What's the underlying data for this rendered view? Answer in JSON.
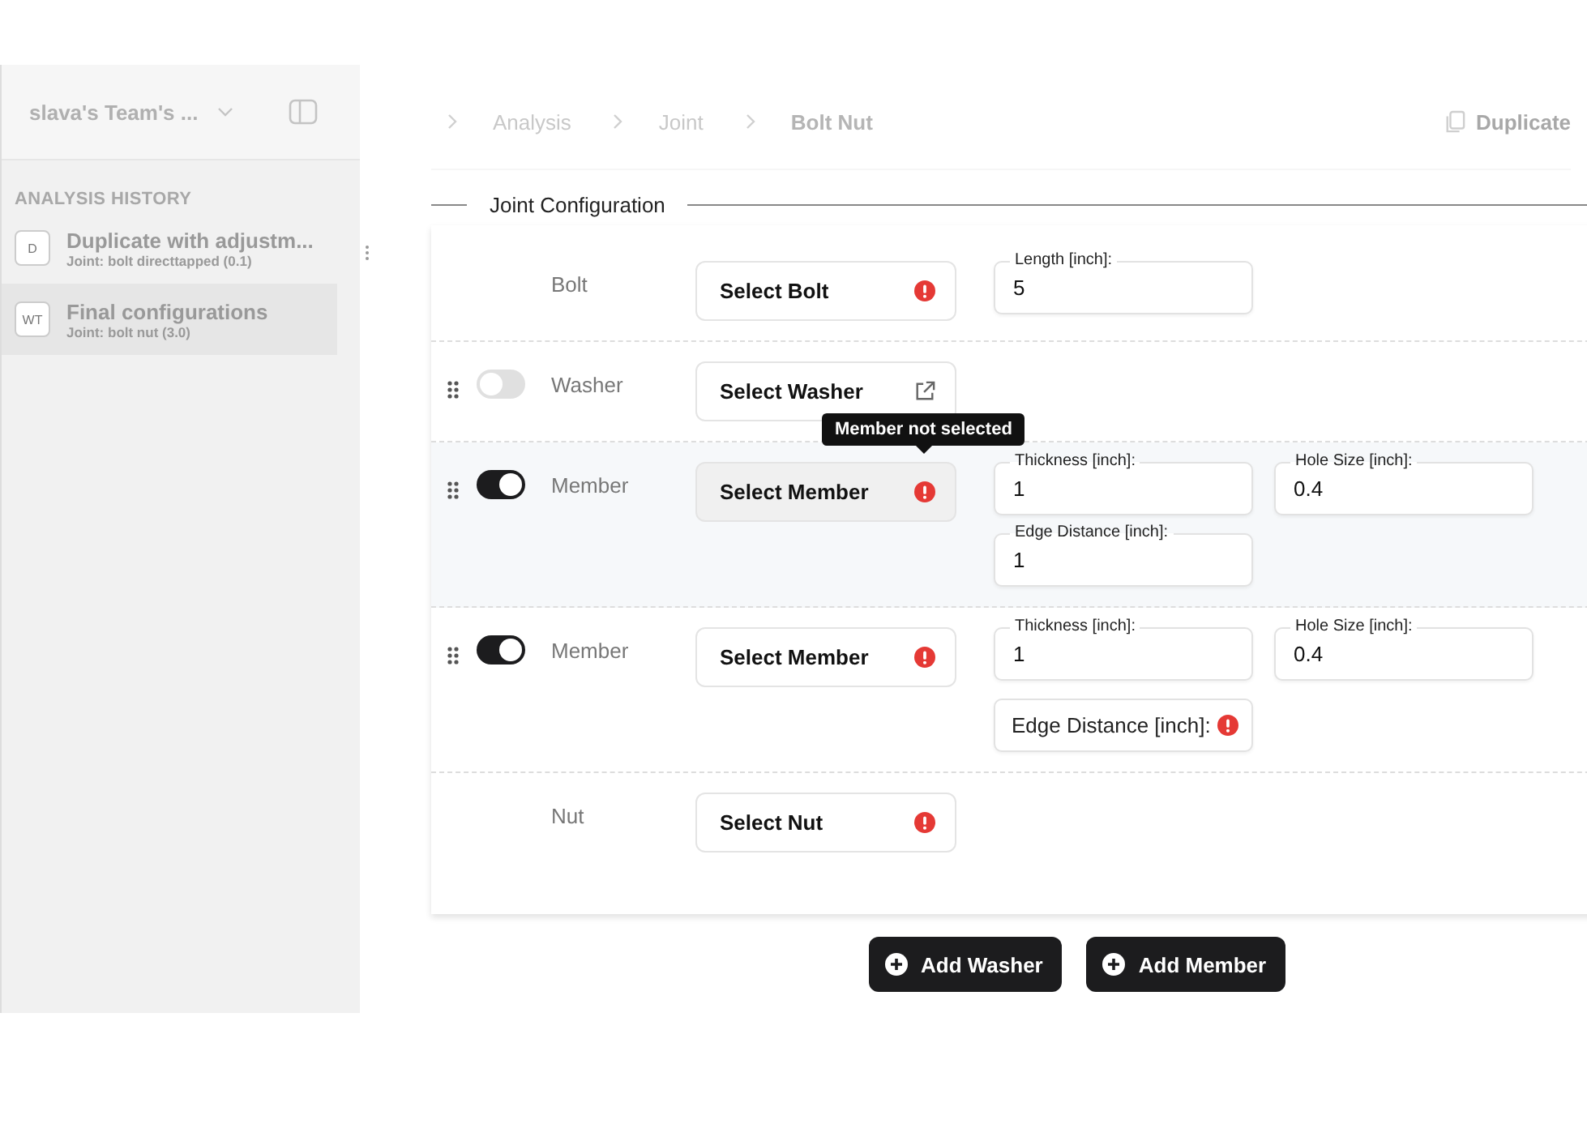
{
  "sidebar": {
    "team": "slava's Team's ...",
    "section_title": "ANALYSIS HISTORY",
    "items": [
      {
        "badge": "D",
        "title": "Duplicate with adjustm...",
        "subtitle": "Joint: bolt directtapped (0.1)",
        "selected": false
      },
      {
        "badge": "WT",
        "title": "Final configurations",
        "subtitle": "Joint: bolt nut (3.0)",
        "selected": true
      }
    ]
  },
  "breadcrumb": [
    "Analysis",
    "Joint",
    "Bolt Nut"
  ],
  "duplicate_button": "Duplicate",
  "section_title": "Joint Configuration",
  "rows": [
    {
      "label": "Bolt",
      "draggable": false,
      "highlighted": false,
      "select": {
        "text": "Select Bolt",
        "error": true,
        "external_link": false
      },
      "fields": [
        {
          "label": "Length [inch]:",
          "value": "5",
          "error": false
        }
      ]
    },
    {
      "label": "Washer",
      "draggable": true,
      "toggle": {
        "on": false
      },
      "highlighted": false,
      "select": {
        "text": "Select Washer",
        "error": false,
        "external_link": true
      },
      "fields": []
    },
    {
      "label": "Member",
      "draggable": true,
      "toggle": {
        "on": true
      },
      "highlighted": true,
      "select": {
        "text": "Select Member",
        "error": true,
        "external_link": false,
        "tooltip": "Member not selected"
      },
      "fields": [
        {
          "label": "Thickness [inch]:",
          "value": "1",
          "error": false
        },
        {
          "label": "Hole Size [inch]:",
          "value": "0.4",
          "error": false
        },
        {
          "label": "Edge Distance [inch]:",
          "value": "1",
          "error": false
        }
      ]
    },
    {
      "label": "Member",
      "draggable": true,
      "toggle": {
        "on": true
      },
      "highlighted": false,
      "select": {
        "text": "Select Member",
        "error": true,
        "external_link": false
      },
      "fields": [
        {
          "label": "Thickness [inch]:",
          "value": "1",
          "error": false
        },
        {
          "label": "Hole Size [inch]:",
          "value": "0.4",
          "error": false
        },
        {
          "label": "Edge Distance [inch]:",
          "error": true
        }
      ]
    },
    {
      "label": "Nut",
      "draggable": false,
      "highlighted": false,
      "select": {
        "text": "Select Nut",
        "error": true,
        "external_link": false
      },
      "fields": []
    }
  ],
  "add_buttons": [
    "Add Washer",
    "Add Member"
  ]
}
